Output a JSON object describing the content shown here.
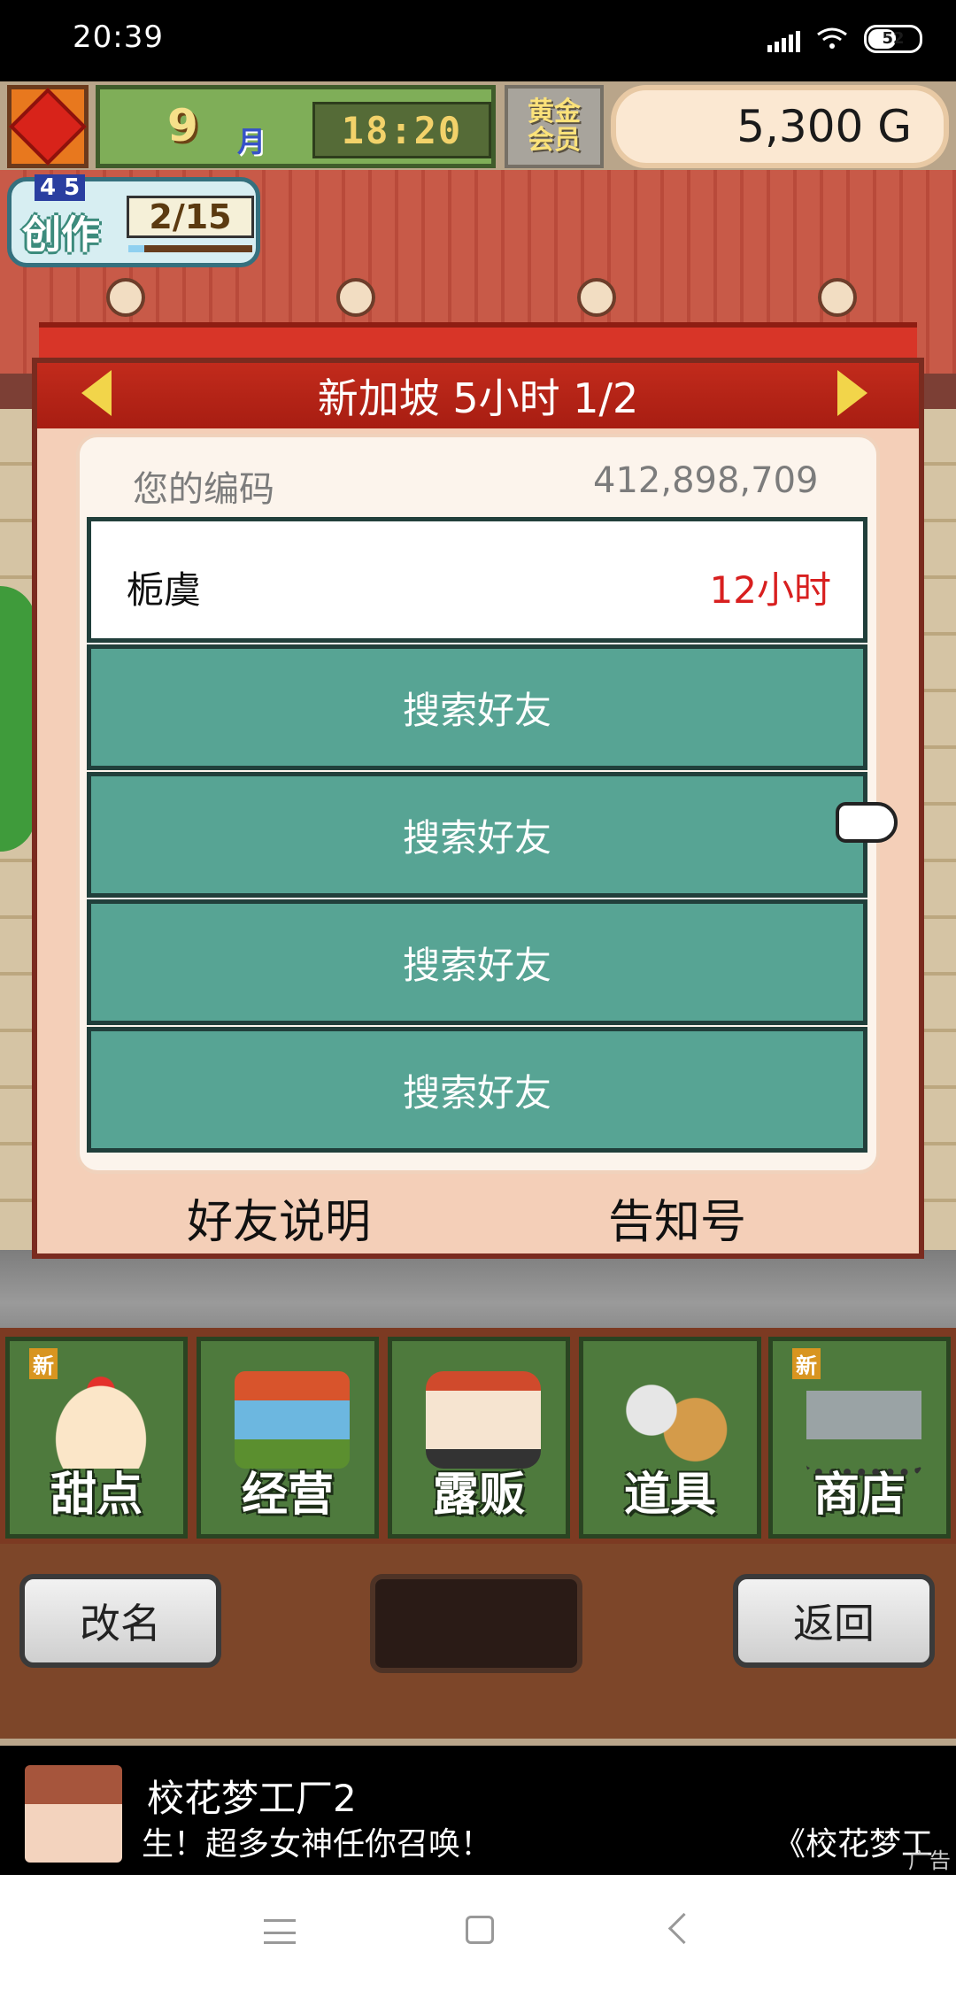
{
  "status_bar": {
    "time": "20:39",
    "battery": "52",
    "icons": [
      "signal-icon",
      "wifi-icon",
      "battery-icon"
    ]
  },
  "hud": {
    "month_number": "9",
    "month_label": "月",
    "clock": "18:20",
    "gold_badge": "黄金会员",
    "money": "5,300 G",
    "create_label": "创作",
    "create_top": "4 5",
    "create_count": "2/15",
    "create_progress": 0.13
  },
  "dialog": {
    "title": "新加坡  5小时 1/2",
    "code_label": "您的编码",
    "code_value": "412,898,709",
    "friend": {
      "name": "栀虞",
      "time": "12小时"
    },
    "search_rows": [
      "搜索好友",
      "搜索好友",
      "搜索好友",
      "搜索好友"
    ],
    "friend_help": "好友说明",
    "notice": "告知号"
  },
  "menu": {
    "items": [
      {
        "label": "甜点",
        "new": "新",
        "icon": "cake-icon"
      },
      {
        "label": "经营",
        "new": "",
        "icon": "store-icon"
      },
      {
        "label": "露贩",
        "new": "",
        "icon": "food-truck-icon"
      },
      {
        "label": "道具",
        "new": "",
        "icon": "item-bag-icon"
      },
      {
        "label": "商店",
        "new": "新",
        "icon": "shopping-cart-icon"
      }
    ]
  },
  "bottom": {
    "rename": "改名",
    "back": "返回"
  },
  "ad": {
    "title": "校花梦工厂2",
    "text": "生！超多女神任你召唤！",
    "text_right": "《校花梦工",
    "tag": "广告"
  }
}
